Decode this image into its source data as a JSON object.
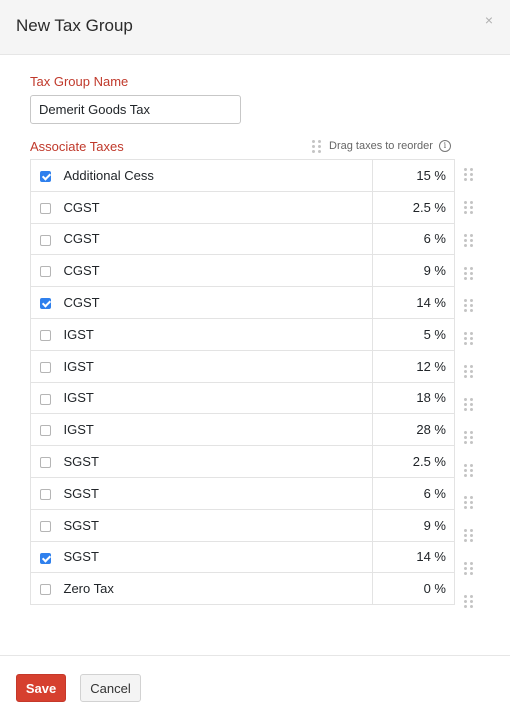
{
  "dialog": {
    "title": "New Tax Group",
    "close_glyph": "×"
  },
  "form": {
    "name_label": "Tax Group Name",
    "name_value": "Demerit Goods Tax",
    "associate_label": "Associate Taxes",
    "drag_hint": "Drag taxes to reorder",
    "info_glyph": "i"
  },
  "taxes": [
    {
      "name": "Additional Cess",
      "rate": "15 %",
      "checked": true
    },
    {
      "name": "CGST",
      "rate": "2.5 %",
      "checked": false
    },
    {
      "name": "CGST",
      "rate": "6 %",
      "checked": false
    },
    {
      "name": "CGST",
      "rate": "9 %",
      "checked": false
    },
    {
      "name": "CGST",
      "rate": "14 %",
      "checked": true
    },
    {
      "name": "IGST",
      "rate": "5 %",
      "checked": false
    },
    {
      "name": "IGST",
      "rate": "12 %",
      "checked": false
    },
    {
      "name": "IGST",
      "rate": "18 %",
      "checked": false
    },
    {
      "name": "IGST",
      "rate": "28 %",
      "checked": false
    },
    {
      "name": "SGST",
      "rate": "2.5 %",
      "checked": false
    },
    {
      "name": "SGST",
      "rate": "6 %",
      "checked": false
    },
    {
      "name": "SGST",
      "rate": "9 %",
      "checked": false
    },
    {
      "name": "SGST",
      "rate": "14 %",
      "checked": true
    },
    {
      "name": "Zero Tax",
      "rate": "0 %",
      "checked": false
    }
  ],
  "footer": {
    "save_label": "Save",
    "cancel_label": "Cancel"
  },
  "colors": {
    "accent_red": "#d6402f",
    "label_red": "#c0392b",
    "checkbox_blue": "#2f80ed"
  },
  "icons": {
    "close": "close-icon",
    "drag": "drag-handle-icon",
    "info": "info-icon"
  }
}
